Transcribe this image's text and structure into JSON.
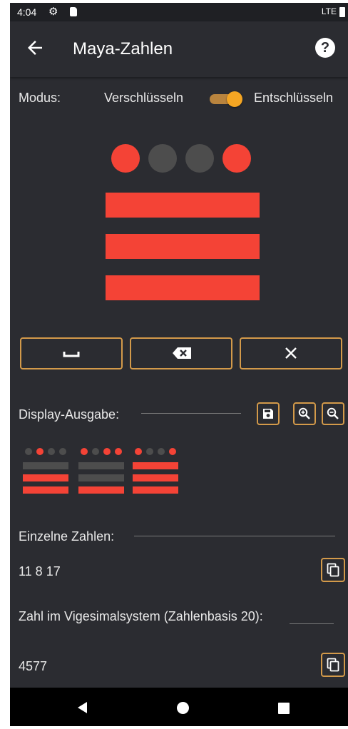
{
  "status_bar": {
    "time": "4:04",
    "network": "LTE"
  },
  "app_bar": {
    "title": "Maya-Zahlen",
    "help_glyph": "?"
  },
  "mode": {
    "label": "Modus:",
    "encrypt": "Verschlüsseln",
    "decrypt": "Entschlüsseln",
    "toggle_on": true
  },
  "glyph_large": {
    "dots": [
      true,
      false,
      false,
      true
    ],
    "bars": 3
  },
  "keyboard": {
    "space_icon": "space-bar-icon",
    "backspace_icon": "backspace-icon",
    "clear_icon": "close-icon"
  },
  "display": {
    "label": "Display-Ausgabe:",
    "icons": [
      "save-icon",
      "zoom-in-icon",
      "zoom-out-icon"
    ]
  },
  "glyphs_output": [
    {
      "dots": [
        false,
        true,
        false,
        false
      ],
      "bars": [
        false,
        true,
        true
      ]
    },
    {
      "dots": [
        true,
        false,
        true,
        true
      ],
      "bars": [
        false,
        false,
        true
      ]
    },
    {
      "dots": [
        true,
        false,
        false,
        true
      ],
      "bars": [
        true,
        true,
        true
      ]
    }
  ],
  "single_numbers": {
    "label": "Einzelne Zahlen:",
    "value": "11 8 17"
  },
  "vigesimal": {
    "label": "Zahl im Vigesimalsystem (Zahlenbasis 20):",
    "value": "4577"
  },
  "colors": {
    "accent": "#f5a623",
    "outline": "#d39a4a",
    "glyph_red": "#f44336",
    "glyph_grey": "#4d4d4d",
    "background": "#2b2c31"
  }
}
